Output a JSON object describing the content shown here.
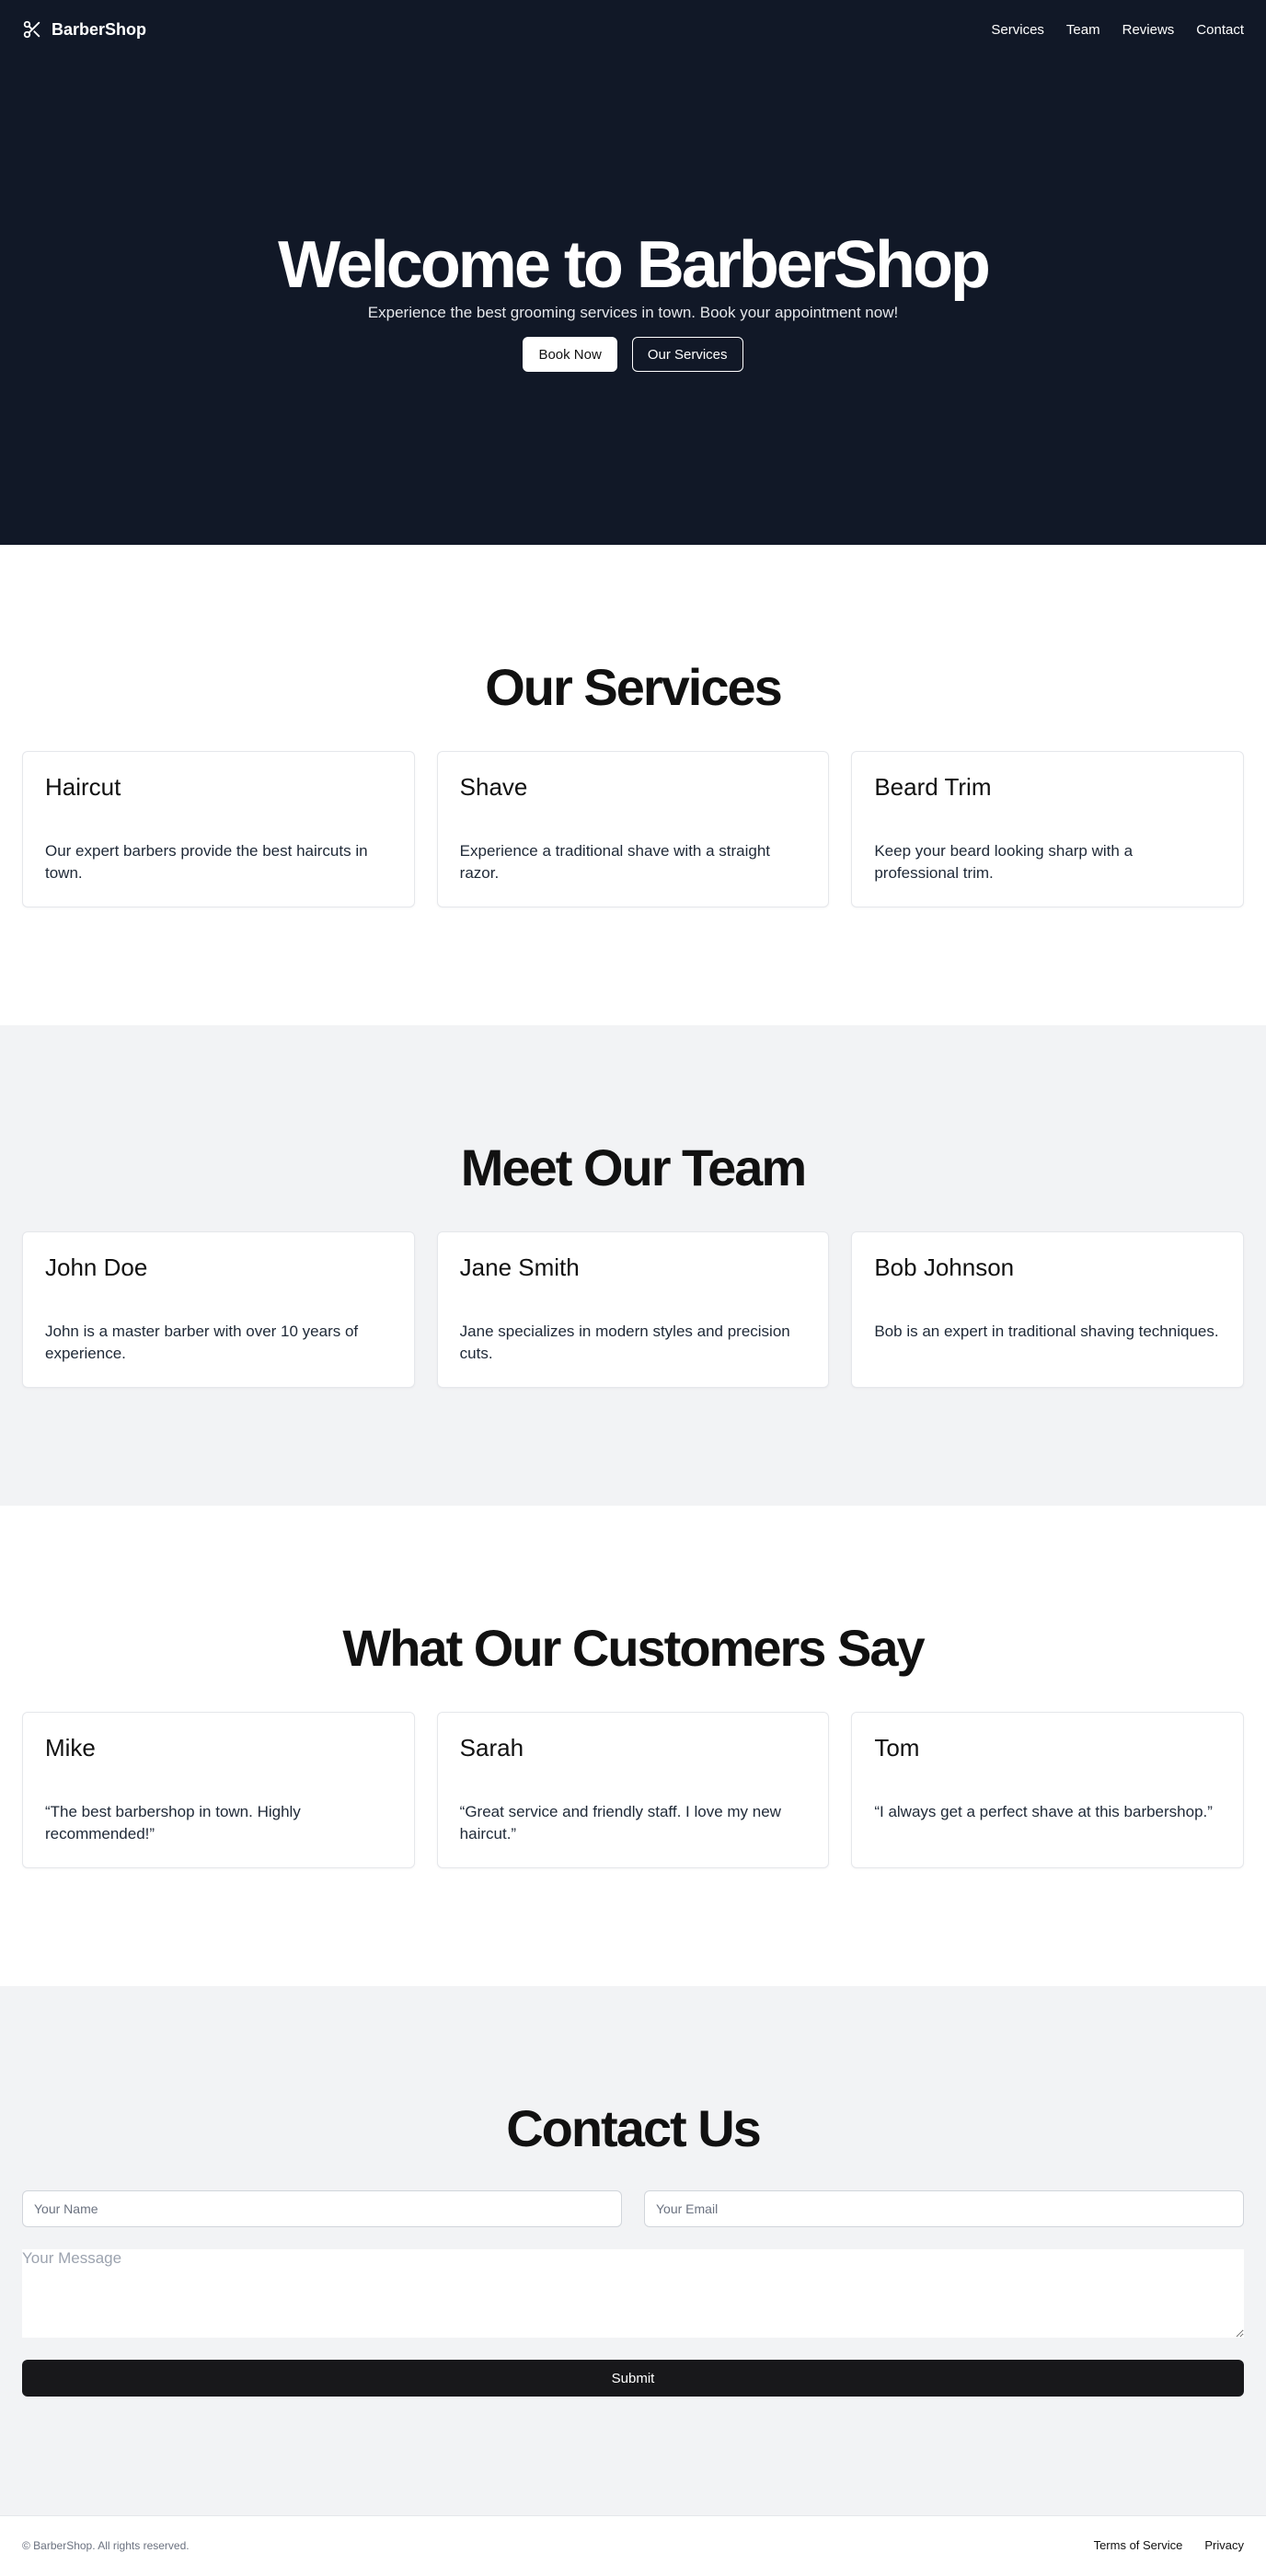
{
  "header": {
    "brand": "BarberShop",
    "brand_icon": "scissors-icon",
    "nav": [
      "Services",
      "Team",
      "Reviews",
      "Contact"
    ]
  },
  "hero": {
    "title": "Welcome to BarberShop",
    "subtitle": "Experience the best grooming services in town. Book your appointment now!",
    "primary_button": "Book Now",
    "secondary_button": "Our Services"
  },
  "services": {
    "title": "Our Services",
    "items": [
      {
        "title": "Haircut",
        "text": "Our expert barbers provide the best haircuts in town."
      },
      {
        "title": "Shave",
        "text": "Experience a traditional shave with a straight razor."
      },
      {
        "title": "Beard Trim",
        "text": "Keep your beard looking sharp with a professional trim."
      }
    ]
  },
  "team": {
    "title": "Meet Our Team",
    "items": [
      {
        "title": "John Doe",
        "text": "John is a master barber with over 10 years of experience."
      },
      {
        "title": "Jane Smith",
        "text": "Jane specializes in modern styles and precision cuts."
      },
      {
        "title": "Bob Johnson",
        "text": "Bob is an expert in traditional shaving techniques."
      }
    ]
  },
  "reviews": {
    "title": "What Our Customers Say",
    "items": [
      {
        "title": "Mike",
        "text": "“The best barbershop in town. Highly recommended!”"
      },
      {
        "title": "Sarah",
        "text": "“Great service and friendly staff. I love my new haircut.”"
      },
      {
        "title": "Tom",
        "text": "“I always get a perfect shave at this barbershop.”"
      }
    ]
  },
  "contact": {
    "title": "Contact Us",
    "name_placeholder": "Your Name",
    "email_placeholder": "Your Email",
    "message_placeholder": "Your Message",
    "submit_label": "Submit"
  },
  "footer": {
    "copyright": "© BarberShop. All rights reserved.",
    "links": [
      "Terms of Service",
      "Privacy"
    ]
  },
  "colors": {
    "hero_bg": "#111827",
    "section_gray": "#f2f3f5",
    "submit_bg": "#18181b"
  }
}
